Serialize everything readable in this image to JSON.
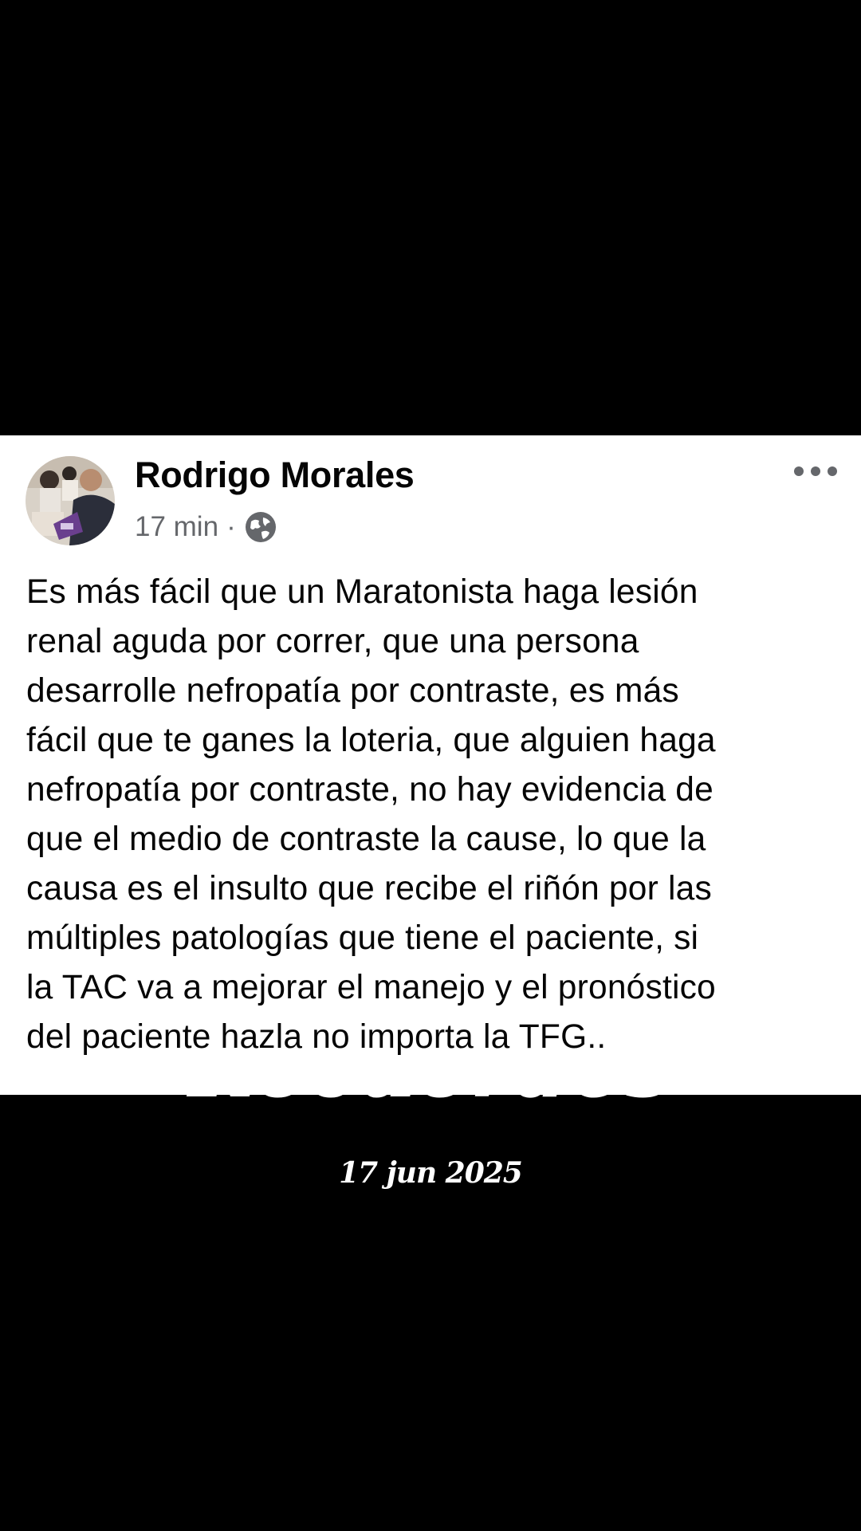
{
  "overlay": {
    "title": "Recuerdos",
    "date": "17 jun 2025"
  },
  "post": {
    "author": "Rodrigo Morales",
    "time": "17 min",
    "separator": "·",
    "privacy_icon": "globe-icon",
    "more_icon": "more-options-icon",
    "text": "Es más fácil que un Maratonista haga lesión\nrenal aguda por correr, que una persona\ndesarrolle nefropatía por contraste, es más\nfácil que te ganes la loteria, que alguien haga\nnefropatía por contraste, no hay evidencia de\nque el medio de contraste la cause, lo que la\ncausa es el insulto que recibe el riñón por las\nmúltiples patologías que tiene el paciente, si\nla TAC va a mejorar el manejo y el pronóstico\ndel paciente hazla no importa la TFG.."
  },
  "colors": {
    "background": "#000000",
    "card": "#ffffff",
    "text_primary": "#050505",
    "text_secondary": "#65676b"
  }
}
